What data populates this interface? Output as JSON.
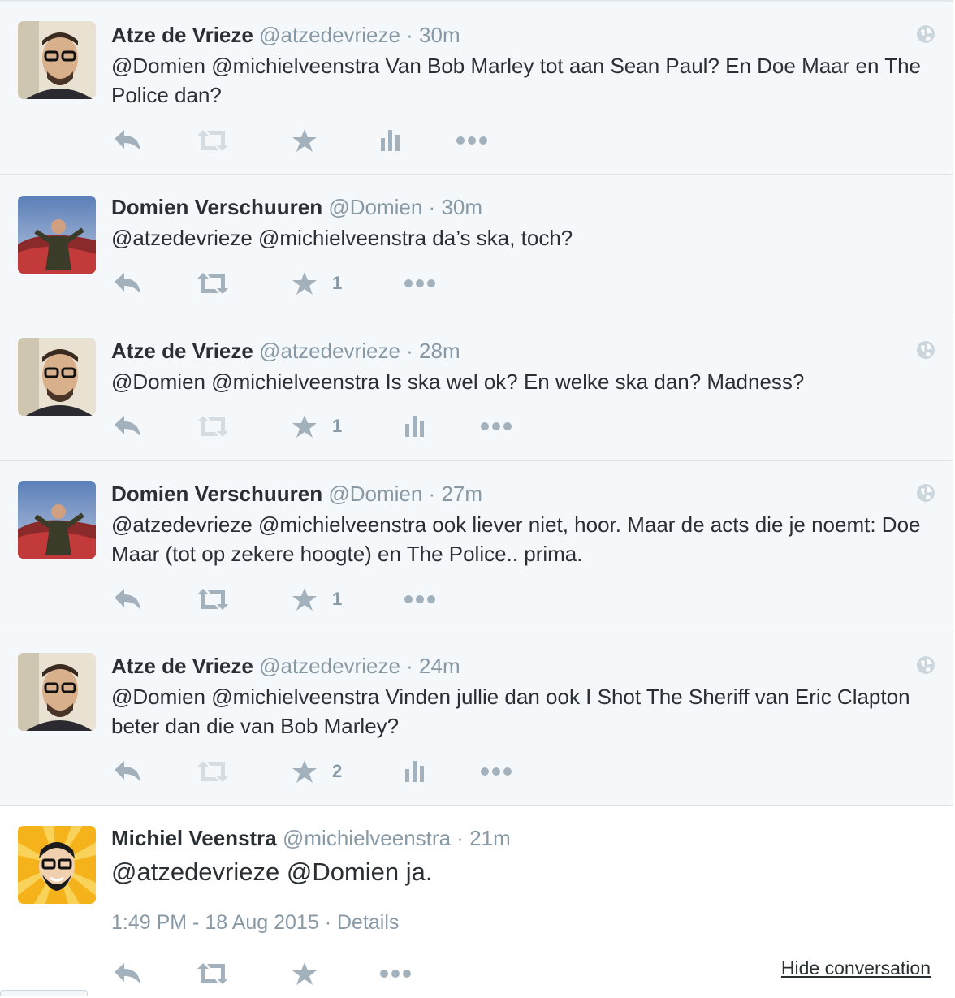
{
  "tweets": [
    {
      "fullname": "Atze de Vrieze",
      "username": "@atzedevrieze",
      "separator": "·",
      "time": "30m",
      "text": "@Domien @michielveenstra Van Bob Marley tot aan Sean Paul? En Doe Maar en The Police dan?",
      "avatar": "atze-avatar",
      "favorite_count": "",
      "has_analytics": true,
      "has_globe": true
    },
    {
      "fullname": "Domien Verschuuren",
      "username": "@Domien",
      "separator": "·",
      "time": "30m",
      "text": "@atzedevrieze @michielveenstra da’s ska, toch?",
      "avatar": "domien-avatar",
      "favorite_count": "1",
      "has_analytics": false,
      "has_globe": false
    },
    {
      "fullname": "Atze de Vrieze",
      "username": "@atzedevrieze",
      "separator": "·",
      "time": "28m",
      "text": "@Domien @michielveenstra Is ska wel ok? En welke ska dan? Madness?",
      "avatar": "atze-avatar",
      "favorite_count": "1",
      "has_analytics": true,
      "has_globe": true
    },
    {
      "fullname": "Domien Verschuuren",
      "username": "@Domien",
      "separator": "·",
      "time": "27m",
      "text": "@atzedevrieze @michielveenstra ook liever niet, hoor. Maar de acts die je noemt: Doe Maar (tot op zekere hoogte) en The Police.. prima.",
      "avatar": "domien-avatar",
      "favorite_count": "1",
      "has_analytics": false,
      "has_globe": true
    },
    {
      "fullname": "Atze de Vrieze",
      "username": "@atzedevrieze",
      "separator": "·",
      "time": "24m",
      "text": "@Domien @michielveenstra Vinden jullie dan ook I Shot The Sheriff van Eric Clapton beter dan die van Bob Marley?",
      "avatar": "atze-avatar",
      "favorite_count": "2",
      "has_analytics": true,
      "has_globe": true
    }
  ],
  "focused_tweet": {
    "fullname": "Michiel Veenstra",
    "username": "@michielveenstra",
    "separator": "·",
    "time": "21m",
    "text": "@atzedevrieze @Domien ja.",
    "avatar": "michiel-avatar",
    "timestamp": "1:49 PM - 18 Aug 2015",
    "meta_separator": "·",
    "details_label": "Details",
    "hide_conversation_label": "Hide conversation"
  },
  "icons": {
    "reply": "reply-icon",
    "retweet": "retweet-icon",
    "favorite": "star-icon",
    "analytics": "analytics-icon",
    "more": "more-icon",
    "globe": "globe-icon"
  },
  "colors": {
    "tweet_background": "#f5f8fa",
    "focused_background": "#ffffff",
    "name_text": "#292f33",
    "secondary_text": "#8899a6",
    "action_icon": "#a3b1bc",
    "retweet_disabled": "#d5dde3",
    "border": "#e1e8ed"
  }
}
